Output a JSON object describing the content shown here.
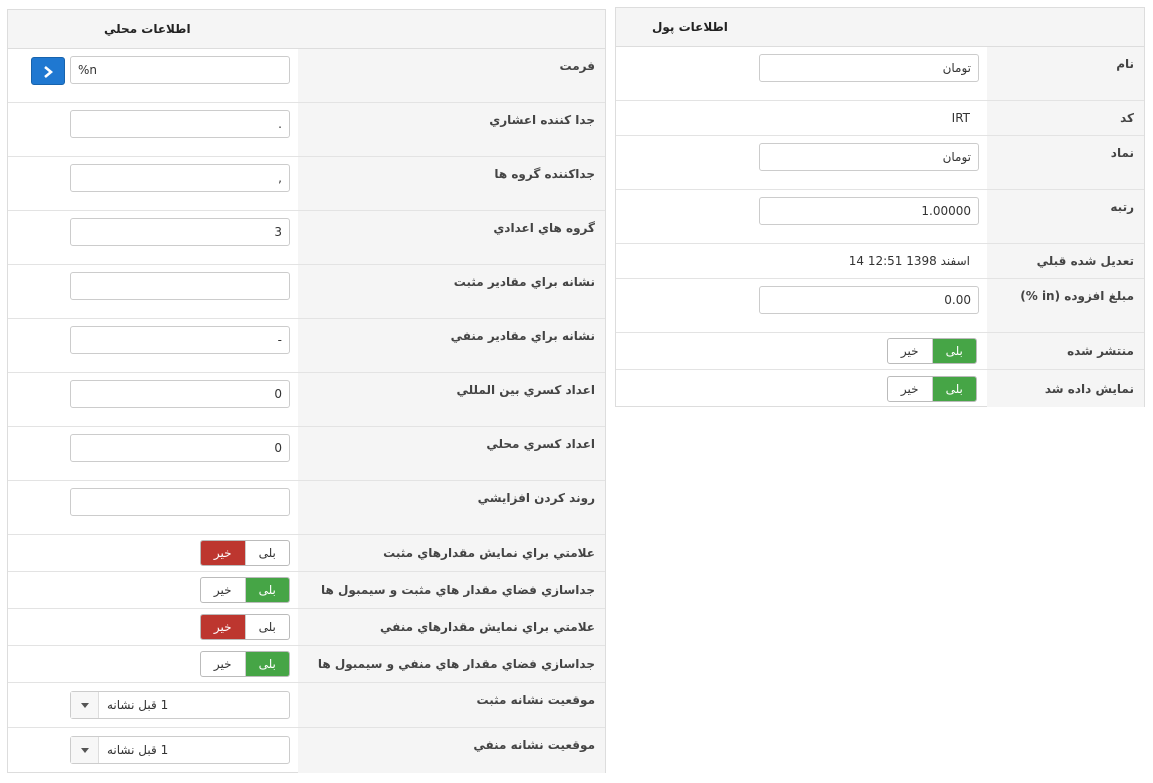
{
  "left_panel": {
    "title": "اطلاعات محلي",
    "format": {
      "label": "فرمت",
      "value": "%n"
    },
    "fields": [
      {
        "label": "جدا كننده اعشاري",
        "value": "."
      },
      {
        "label": "جداكننده گروه ها",
        "value": ","
      },
      {
        "label": "گروه هاي اعدادي",
        "value": "3"
      },
      {
        "label": "نشانه براي مقادير مثبت",
        "value": ""
      },
      {
        "label": "نشانه براي مقادير منفي",
        "value": "-"
      },
      {
        "label": "اعداد كسري بين المللي",
        "value": "0"
      },
      {
        "label": "اعداد كسري محلي",
        "value": "0"
      },
      {
        "label": "روند كردن افزايشي",
        "value": ""
      }
    ],
    "toggles": [
      {
        "label": "علامتي براي نمايش مقدارهاي مثبت",
        "yes": "بلی",
        "no": "خیر",
        "selected": "no"
      },
      {
        "label": "جداسازي فضاي مقدار هاي مثبت و سيمبول ها",
        "yes": "بلی",
        "no": "خیر",
        "selected": "yes"
      },
      {
        "label": "علامتي براي نمايش مقدارهاي منفي",
        "yes": "بلی",
        "no": "خیر",
        "selected": "no"
      },
      {
        "label": "جداسازي فضاي مقدار هاي منفي و سيمبول ها",
        "yes": "بلی",
        "no": "خیر",
        "selected": "yes"
      }
    ],
    "selects": [
      {
        "label": "موقعيت نشانه مثبت",
        "value": "1 قبل نشانه"
      },
      {
        "label": "موقعيت نشانه منفي",
        "value": "1 قبل نشانه"
      }
    ]
  },
  "right_panel": {
    "title": "اطلاعات پول",
    "name": {
      "label": "نام",
      "value": "تومان"
    },
    "code": {
      "label": "كد",
      "value": "IRT"
    },
    "symbol": {
      "label": "نماد",
      "value": "تومان"
    },
    "rate": {
      "label": "رتبه",
      "value": "1.00000"
    },
    "modified": {
      "label": "تعديل شده قبلي",
      "value": "14 اسفند 1398 12:51"
    },
    "surcharge": {
      "label": "مبلغ افزوده (in %)",
      "value": "0.00"
    },
    "published": {
      "label": "منتشر شده",
      "yes": "بلی",
      "no": "خیر",
      "selected": "yes"
    },
    "displayed": {
      "label": "نمايش داده شد",
      "yes": "بلی",
      "no": "خیر",
      "selected": "yes"
    }
  },
  "colors": {
    "accent_blue": "#1f78d1",
    "yes_green": "#46a546",
    "no_red": "#bd362f",
    "label_bg": "#f5f5f5",
    "border": "#dddddd"
  },
  "icons": {
    "format_button": "chevron-right-icon",
    "select_caret": "caret-down-icon"
  }
}
